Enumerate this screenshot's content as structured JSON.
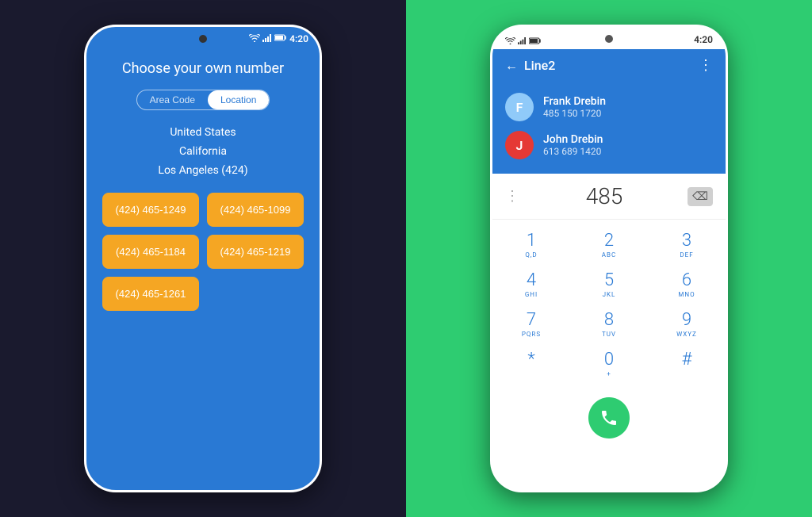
{
  "leftPhone": {
    "statusBar": {
      "time": "4:20",
      "wifiIcon": "📶",
      "signalIcon": "▲",
      "batteryIcon": "▮"
    },
    "title": "Choose your own number",
    "toggleAreaCode": "Area Code",
    "toggleLocation": "Location",
    "selectedToggle": "Location",
    "locations": [
      "United States",
      "California",
      "Los Angeles (424)"
    ],
    "numbers": [
      "(424) 465-1249",
      "(424) 465-1099",
      "(424) 465-1184",
      "(424) 465-1219",
      "(424) 465-1261"
    ]
  },
  "rightPhone": {
    "statusBar": {
      "time": "4:20"
    },
    "header": {
      "backLabel": "←",
      "title": "Line2",
      "moreIcon": "⋮"
    },
    "contacts": [
      {
        "initial": "F",
        "name": "Frank Drebin",
        "number": "485 150 1720",
        "avatarClass": "avatar-blue"
      },
      {
        "initial": "J",
        "name": "John Drebin",
        "number": "613 689 1420",
        "avatarClass": "avatar-red"
      }
    ],
    "dialerNumber": "485",
    "dialerDeleteIcon": "⌫",
    "dialerDotsIcon": "⋮",
    "dialpad": [
      {
        "digit": "1",
        "letters": "Q,D"
      },
      {
        "digit": "2",
        "letters": "ABC"
      },
      {
        "digit": "3",
        "letters": "DEF"
      },
      {
        "digit": "4",
        "letters": "GHI"
      },
      {
        "digit": "5",
        "letters": "JKL"
      },
      {
        "digit": "6",
        "letters": "MNO"
      },
      {
        "digit": "7",
        "letters": "PQRS"
      },
      {
        "digit": "8",
        "letters": "TUV"
      },
      {
        "digit": "9",
        "letters": "WXYZ"
      },
      {
        "digit": "*",
        "letters": ""
      },
      {
        "digit": "0",
        "letters": "+"
      },
      {
        "digit": "#",
        "letters": ""
      }
    ],
    "callButtonIcon": "📞"
  }
}
